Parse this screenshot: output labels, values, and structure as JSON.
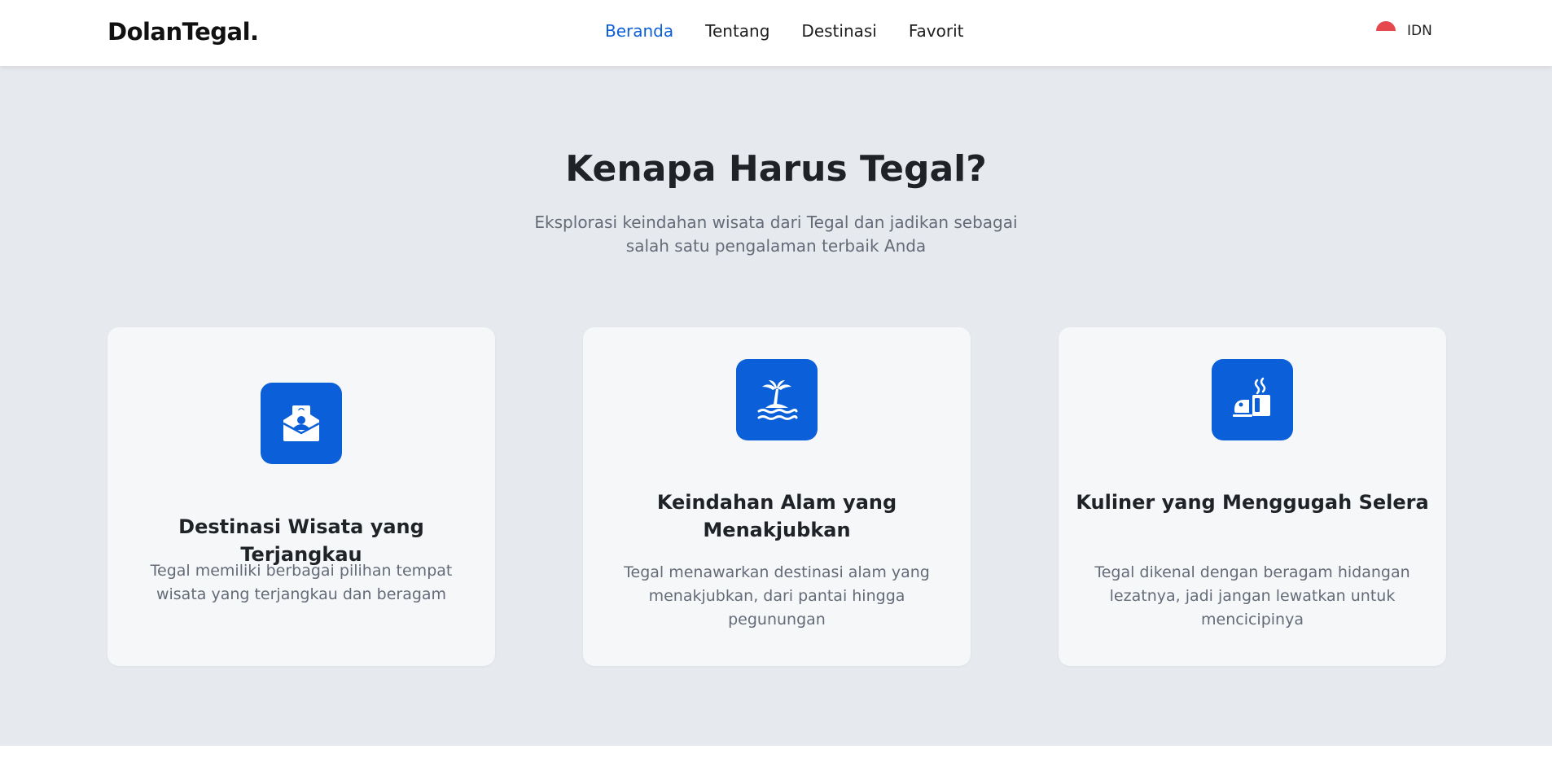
{
  "navbar": {
    "logo": "DolanTegal.",
    "links": [
      {
        "label": "Beranda",
        "active": true
      },
      {
        "label": "Tentang",
        "active": false
      },
      {
        "label": "Destinasi",
        "active": false
      },
      {
        "label": "Favorit",
        "active": false
      }
    ],
    "language": {
      "label": "IDN",
      "flag_icon": "indonesia-flag-icon"
    }
  },
  "section": {
    "title": "Kenapa Harus Tegal?",
    "subtitle": "Eksplorasi keindahan wisata dari Tegal dan jadikan sebagai salah satu pengalaman terbaik Anda"
  },
  "cards": [
    {
      "icon": "money-envelope-icon",
      "title": "Destinasi Wisata yang Terjangkau",
      "description": "Tegal memiliki berbagai pilihan tempat wisata yang terjangkau dan beragam"
    },
    {
      "icon": "island-palm-icon",
      "title": "Keindahan Alam yang Menakjubkan",
      "description": "Tegal menawarkan destinasi alam yang menakjubkan, dari pantai hingga pegunungan"
    },
    {
      "icon": "food-drink-icon",
      "title": "Kuliner yang Menggugah Selera",
      "description": "Tegal dikenal dengan beragam hidangan lezatnya, jadi jangan lewatkan untuk mencicipinya"
    }
  ],
  "colors": {
    "accent": "#0b5fd8",
    "section_bg": "#e6e9ee",
    "card_bg": "#f6f7f9",
    "flag_red": "#e5484d"
  }
}
